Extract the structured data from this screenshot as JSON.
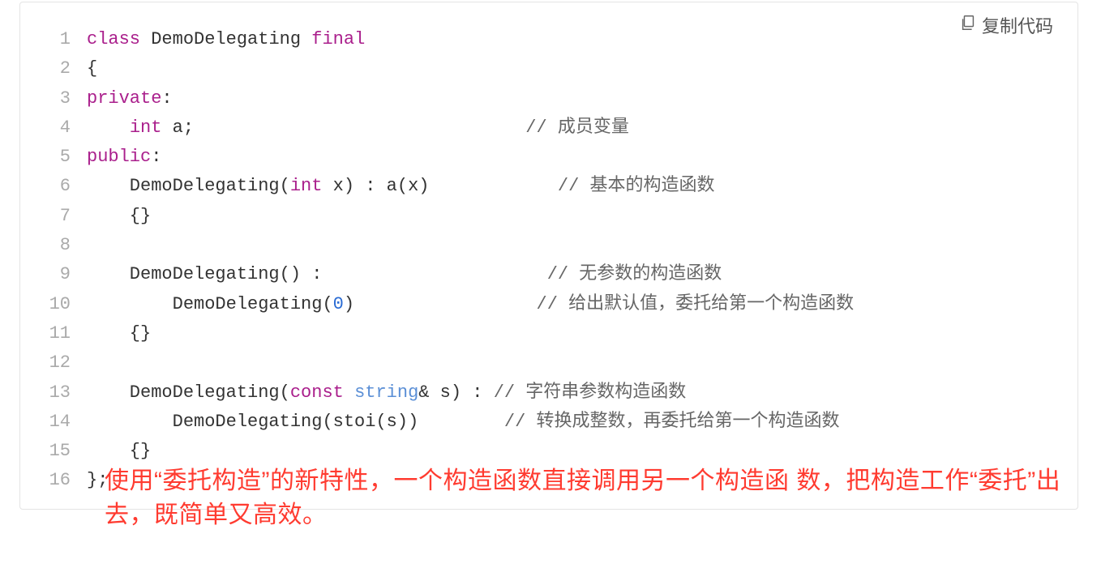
{
  "copy_label": "复制代码",
  "annotation": "使用“委托构造”的新特性，一个构造函数直接调用另一个构造函 数，把构造工作“委托”出去，既简单又高效。",
  "code": [
    {
      "n": "1",
      "tokens": [
        {
          "t": "class ",
          "c": "kw"
        },
        {
          "t": "DemoDelegating ",
          "c": "ident"
        },
        {
          "t": "final",
          "c": "kw"
        }
      ]
    },
    {
      "n": "2",
      "tokens": [
        {
          "t": "{",
          "c": "punct"
        }
      ]
    },
    {
      "n": "3",
      "tokens": [
        {
          "t": "private",
          "c": "kw"
        },
        {
          "t": ":",
          "c": "punct"
        }
      ]
    },
    {
      "n": "4",
      "tokens": [
        {
          "t": "    ",
          "c": "ident"
        },
        {
          "t": "int",
          "c": "kw"
        },
        {
          "t": " a;                               ",
          "c": "ident"
        },
        {
          "t": "// 成员变量",
          "c": "cmt"
        }
      ]
    },
    {
      "n": "5",
      "tokens": [
        {
          "t": "public",
          "c": "kw"
        },
        {
          "t": ":",
          "c": "punct"
        }
      ]
    },
    {
      "n": "6",
      "tokens": [
        {
          "t": "    DemoDelegating(",
          "c": "ident"
        },
        {
          "t": "int",
          "c": "kw"
        },
        {
          "t": " x) : a(x)            ",
          "c": "ident"
        },
        {
          "t": "// 基本的构造函数",
          "c": "cmt"
        }
      ]
    },
    {
      "n": "7",
      "tokens": [
        {
          "t": "    {}",
          "c": "punct"
        }
      ]
    },
    {
      "n": "8",
      "tokens": [
        {
          "t": "",
          "c": "ident"
        }
      ]
    },
    {
      "n": "9",
      "tokens": [
        {
          "t": "    DemoDelegating() :                     ",
          "c": "ident"
        },
        {
          "t": "// 无参数的构造函数",
          "c": "cmt"
        }
      ]
    },
    {
      "n": "10",
      "tokens": [
        {
          "t": "        DemoDelegating(",
          "c": "ident"
        },
        {
          "t": "0",
          "c": "num"
        },
        {
          "t": ")                 ",
          "c": "ident"
        },
        {
          "t": "// 给出默认值，委托给第一个构造函数",
          "c": "cmt"
        }
      ]
    },
    {
      "n": "11",
      "tokens": [
        {
          "t": "    {}",
          "c": "punct"
        }
      ]
    },
    {
      "n": "12",
      "tokens": [
        {
          "t": "",
          "c": "ident"
        }
      ]
    },
    {
      "n": "13",
      "tokens": [
        {
          "t": "    DemoDelegating(",
          "c": "ident"
        },
        {
          "t": "const ",
          "c": "kw"
        },
        {
          "t": "string",
          "c": "type"
        },
        {
          "t": "& s) : ",
          "c": "ident"
        },
        {
          "t": "// 字符串参数构造函数",
          "c": "cmt"
        }
      ]
    },
    {
      "n": "14",
      "tokens": [
        {
          "t": "        DemoDelegating(stoi(s))        ",
          "c": "ident"
        },
        {
          "t": "// 转换成整数，再委托给第一个构造函数",
          "c": "cmt"
        }
      ]
    },
    {
      "n": "15",
      "tokens": [
        {
          "t": "    {}",
          "c": "punct"
        }
      ]
    },
    {
      "n": "16",
      "tokens": [
        {
          "t": "};",
          "c": "punct"
        }
      ]
    }
  ]
}
